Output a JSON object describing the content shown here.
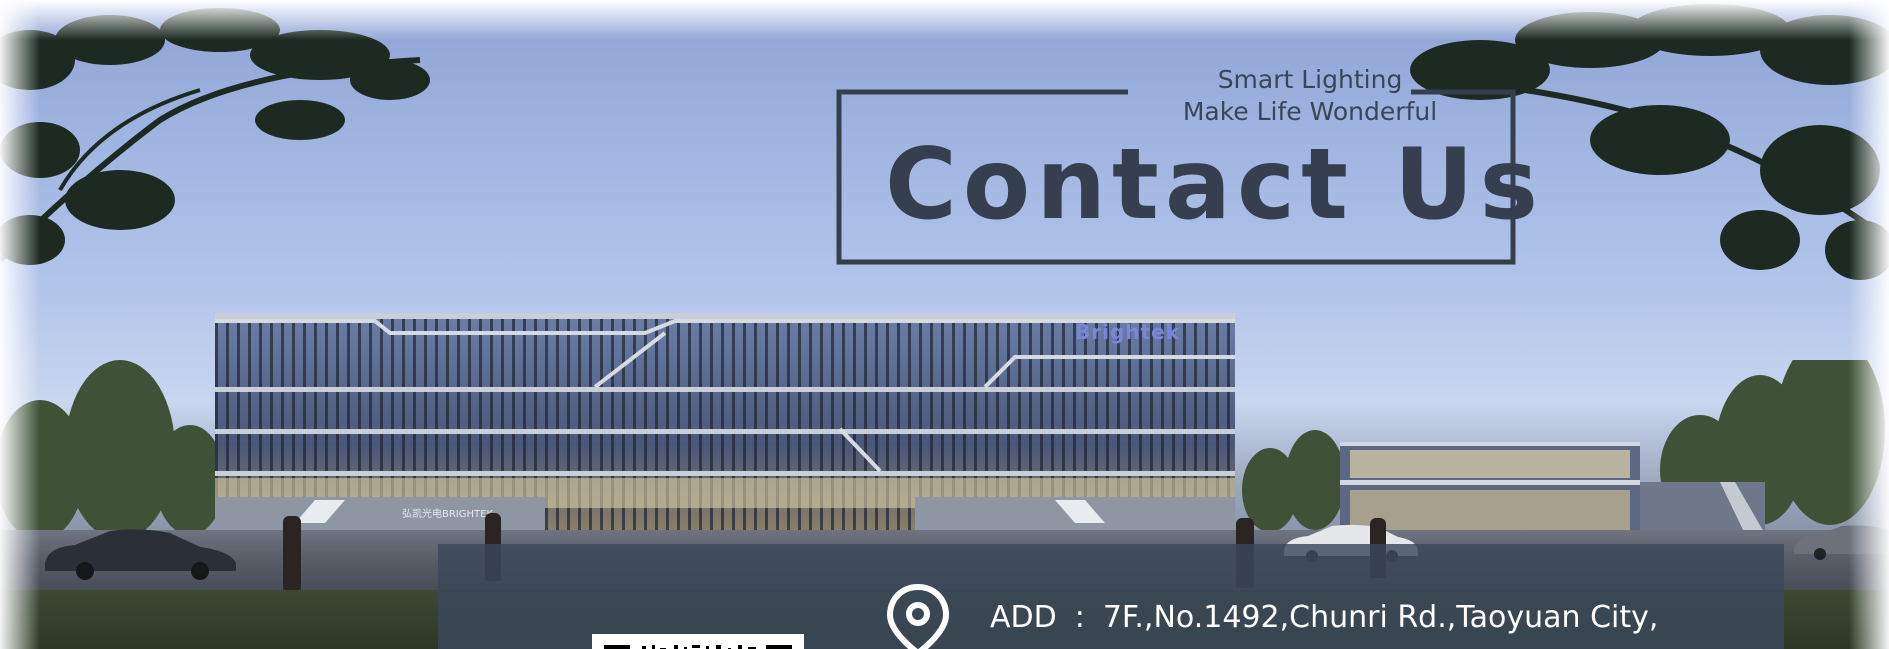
{
  "banner": {
    "slogan_line1": "Smart Lighting",
    "slogan_line2": "Make Life Wonderful",
    "title": "Contact Us"
  },
  "building": {
    "sign_logo": "Brightek",
    "entrance_sign": "弘凯光电BRIGHTEK"
  },
  "contact": {
    "address_label": "ADD",
    "address_separator": ":",
    "address_value": "7F.,No.1492,Chunri Rd.,Taoyuan City,"
  },
  "icons": {
    "location": "map-pin-icon",
    "qr": "qr-code"
  },
  "colors": {
    "title": "#363f4f",
    "panel": "#3a485c",
    "sky": "#9fb3e0"
  }
}
